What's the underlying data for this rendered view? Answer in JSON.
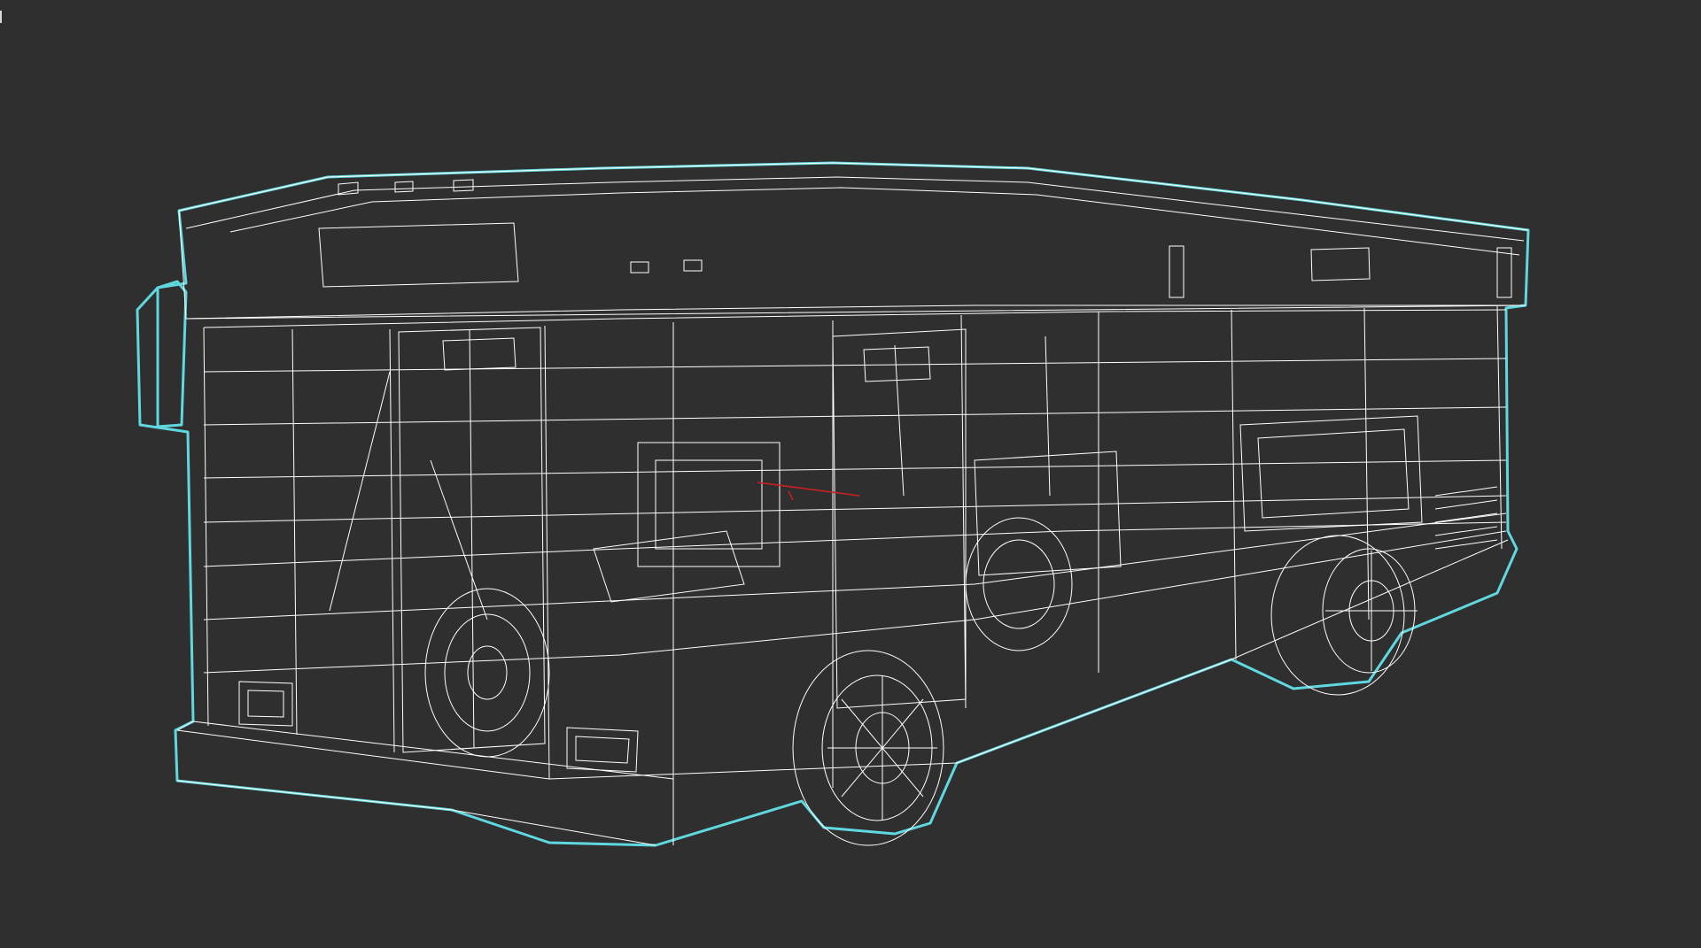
{
  "viewport": {
    "mode": "wireframe",
    "background_color": "#2f2f2f",
    "wire_color": "#ffffff",
    "selection_outline_color": "#5fd8e0",
    "axis_color": "#cc2020"
  },
  "model": {
    "name": "bus",
    "selected": true
  }
}
